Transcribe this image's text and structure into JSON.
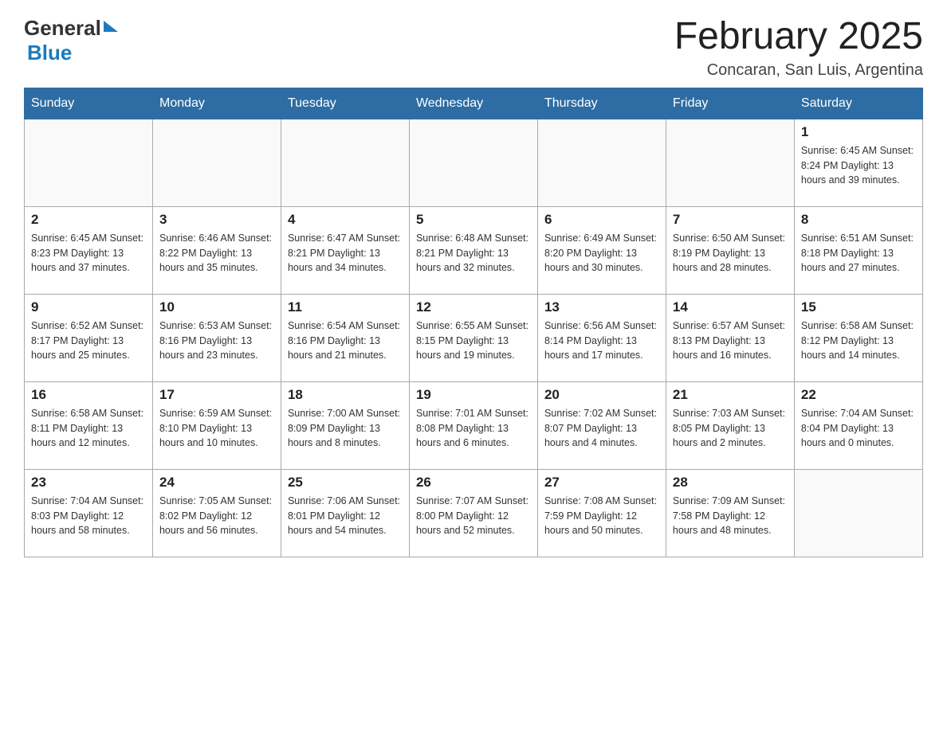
{
  "header": {
    "logo_general": "General",
    "logo_blue": "Blue",
    "month_title": "February 2025",
    "location": "Concaran, San Luis, Argentina"
  },
  "weekdays": [
    "Sunday",
    "Monday",
    "Tuesday",
    "Wednesday",
    "Thursday",
    "Friday",
    "Saturday"
  ],
  "weeks": [
    [
      {
        "day": "",
        "info": ""
      },
      {
        "day": "",
        "info": ""
      },
      {
        "day": "",
        "info": ""
      },
      {
        "day": "",
        "info": ""
      },
      {
        "day": "",
        "info": ""
      },
      {
        "day": "",
        "info": ""
      },
      {
        "day": "1",
        "info": "Sunrise: 6:45 AM\nSunset: 8:24 PM\nDaylight: 13 hours and 39 minutes."
      }
    ],
    [
      {
        "day": "2",
        "info": "Sunrise: 6:45 AM\nSunset: 8:23 PM\nDaylight: 13 hours and 37 minutes."
      },
      {
        "day": "3",
        "info": "Sunrise: 6:46 AM\nSunset: 8:22 PM\nDaylight: 13 hours and 35 minutes."
      },
      {
        "day": "4",
        "info": "Sunrise: 6:47 AM\nSunset: 8:21 PM\nDaylight: 13 hours and 34 minutes."
      },
      {
        "day": "5",
        "info": "Sunrise: 6:48 AM\nSunset: 8:21 PM\nDaylight: 13 hours and 32 minutes."
      },
      {
        "day": "6",
        "info": "Sunrise: 6:49 AM\nSunset: 8:20 PM\nDaylight: 13 hours and 30 minutes."
      },
      {
        "day": "7",
        "info": "Sunrise: 6:50 AM\nSunset: 8:19 PM\nDaylight: 13 hours and 28 minutes."
      },
      {
        "day": "8",
        "info": "Sunrise: 6:51 AM\nSunset: 8:18 PM\nDaylight: 13 hours and 27 minutes."
      }
    ],
    [
      {
        "day": "9",
        "info": "Sunrise: 6:52 AM\nSunset: 8:17 PM\nDaylight: 13 hours and 25 minutes."
      },
      {
        "day": "10",
        "info": "Sunrise: 6:53 AM\nSunset: 8:16 PM\nDaylight: 13 hours and 23 minutes."
      },
      {
        "day": "11",
        "info": "Sunrise: 6:54 AM\nSunset: 8:16 PM\nDaylight: 13 hours and 21 minutes."
      },
      {
        "day": "12",
        "info": "Sunrise: 6:55 AM\nSunset: 8:15 PM\nDaylight: 13 hours and 19 minutes."
      },
      {
        "day": "13",
        "info": "Sunrise: 6:56 AM\nSunset: 8:14 PM\nDaylight: 13 hours and 17 minutes."
      },
      {
        "day": "14",
        "info": "Sunrise: 6:57 AM\nSunset: 8:13 PM\nDaylight: 13 hours and 16 minutes."
      },
      {
        "day": "15",
        "info": "Sunrise: 6:58 AM\nSunset: 8:12 PM\nDaylight: 13 hours and 14 minutes."
      }
    ],
    [
      {
        "day": "16",
        "info": "Sunrise: 6:58 AM\nSunset: 8:11 PM\nDaylight: 13 hours and 12 minutes."
      },
      {
        "day": "17",
        "info": "Sunrise: 6:59 AM\nSunset: 8:10 PM\nDaylight: 13 hours and 10 minutes."
      },
      {
        "day": "18",
        "info": "Sunrise: 7:00 AM\nSunset: 8:09 PM\nDaylight: 13 hours and 8 minutes."
      },
      {
        "day": "19",
        "info": "Sunrise: 7:01 AM\nSunset: 8:08 PM\nDaylight: 13 hours and 6 minutes."
      },
      {
        "day": "20",
        "info": "Sunrise: 7:02 AM\nSunset: 8:07 PM\nDaylight: 13 hours and 4 minutes."
      },
      {
        "day": "21",
        "info": "Sunrise: 7:03 AM\nSunset: 8:05 PM\nDaylight: 13 hours and 2 minutes."
      },
      {
        "day": "22",
        "info": "Sunrise: 7:04 AM\nSunset: 8:04 PM\nDaylight: 13 hours and 0 minutes."
      }
    ],
    [
      {
        "day": "23",
        "info": "Sunrise: 7:04 AM\nSunset: 8:03 PM\nDaylight: 12 hours and 58 minutes."
      },
      {
        "day": "24",
        "info": "Sunrise: 7:05 AM\nSunset: 8:02 PM\nDaylight: 12 hours and 56 minutes."
      },
      {
        "day": "25",
        "info": "Sunrise: 7:06 AM\nSunset: 8:01 PM\nDaylight: 12 hours and 54 minutes."
      },
      {
        "day": "26",
        "info": "Sunrise: 7:07 AM\nSunset: 8:00 PM\nDaylight: 12 hours and 52 minutes."
      },
      {
        "day": "27",
        "info": "Sunrise: 7:08 AM\nSunset: 7:59 PM\nDaylight: 12 hours and 50 minutes."
      },
      {
        "day": "28",
        "info": "Sunrise: 7:09 AM\nSunset: 7:58 PM\nDaylight: 12 hours and 48 minutes."
      },
      {
        "day": "",
        "info": ""
      }
    ]
  ]
}
